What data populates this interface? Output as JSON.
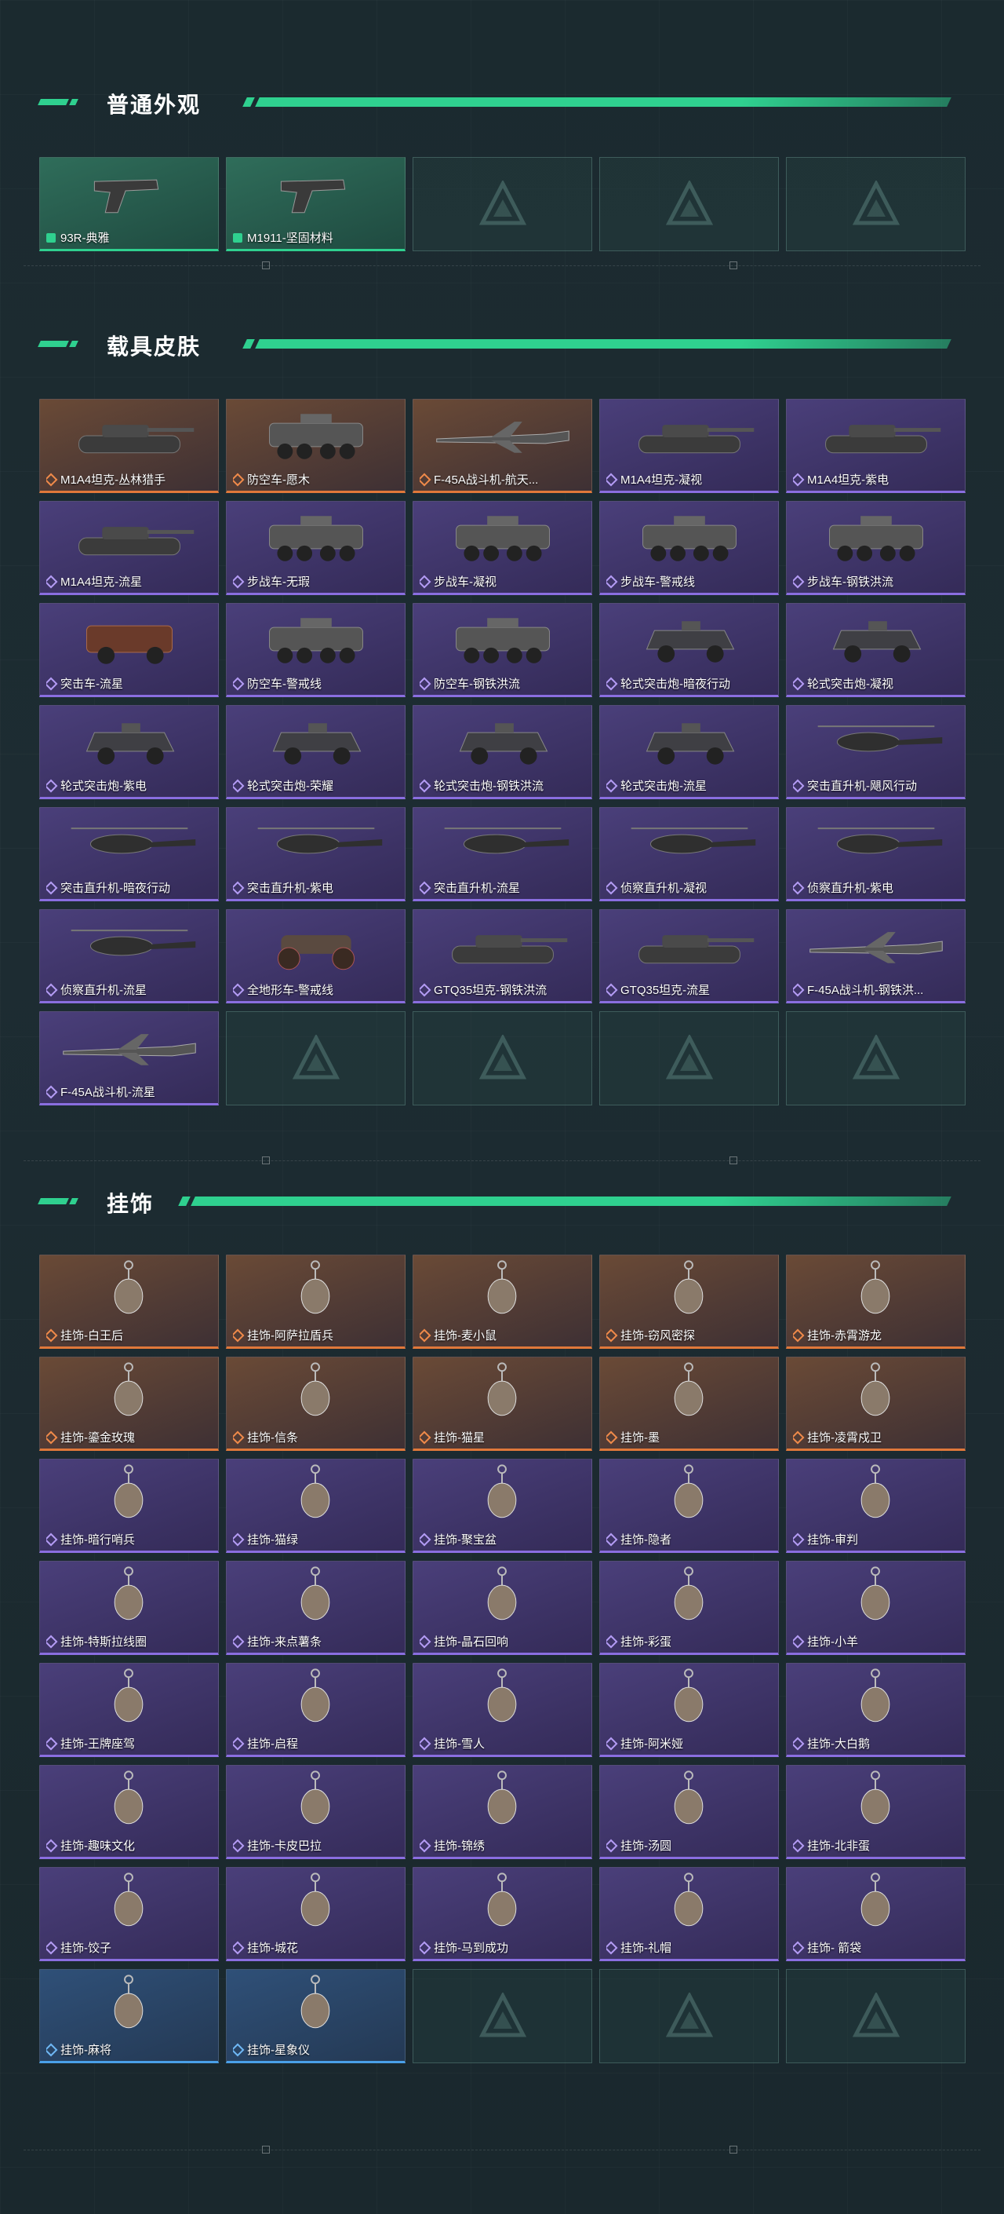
{
  "colors": {
    "accent": "#2fd08f",
    "orange": "#e0783a",
    "purple": "#8a6ee0",
    "blue": "#4aa0e8"
  },
  "sections": [
    {
      "title": "普通外观",
      "items": [
        {
          "label": "93R-典雅",
          "rarity": "green",
          "icon": "pistol-icon"
        },
        {
          "label": "M1911-坚固材料",
          "rarity": "green",
          "icon": "pistol-icon"
        },
        {
          "label": "",
          "rarity": "empty",
          "icon": "placeholder-logo-icon"
        },
        {
          "label": "",
          "rarity": "empty",
          "icon": "placeholder-logo-icon"
        },
        {
          "label": "",
          "rarity": "empty",
          "icon": "placeholder-logo-icon"
        }
      ]
    },
    {
      "title": "载具皮肤",
      "items": [
        {
          "label": "M1A4坦克-丛林猎手",
          "rarity": "orange",
          "icon": "tank-icon"
        },
        {
          "label": "防空车-愿木",
          "rarity": "orange",
          "icon": "apc-icon"
        },
        {
          "label": "F-45A战斗机-航天...",
          "rarity": "orange",
          "icon": "jet-icon"
        },
        {
          "label": "M1A4坦克-凝视",
          "rarity": "purple",
          "icon": "tank-icon"
        },
        {
          "label": "M1A4坦克-紫电",
          "rarity": "purple",
          "icon": "tank-icon"
        },
        {
          "label": "M1A4坦克-流星",
          "rarity": "purple",
          "icon": "tank-icon"
        },
        {
          "label": "步战车-无瑕",
          "rarity": "purple",
          "icon": "apc-icon"
        },
        {
          "label": "步战车-凝视",
          "rarity": "purple",
          "icon": "apc-icon"
        },
        {
          "label": "步战车-警戒线",
          "rarity": "purple",
          "icon": "apc-icon"
        },
        {
          "label": "步战车-钢铁洪流",
          "rarity": "purple",
          "icon": "apc-icon"
        },
        {
          "label": "突击车-流星",
          "rarity": "purple",
          "icon": "truck-icon"
        },
        {
          "label": "防空车-警戒线",
          "rarity": "purple",
          "icon": "apc-icon"
        },
        {
          "label": "防空车-钢铁洪流",
          "rarity": "purple",
          "icon": "apc-icon"
        },
        {
          "label": "轮式突击炮-暗夜行动",
          "rarity": "purple",
          "icon": "armored-car-icon"
        },
        {
          "label": "轮式突击炮-凝视",
          "rarity": "purple",
          "icon": "armored-car-icon"
        },
        {
          "label": "轮式突击炮-紫电",
          "rarity": "purple",
          "icon": "armored-car-icon"
        },
        {
          "label": "轮式突击炮-荣耀",
          "rarity": "purple",
          "icon": "armored-car-icon"
        },
        {
          "label": "轮式突击炮-钢铁洪流",
          "rarity": "purple",
          "icon": "armored-car-icon"
        },
        {
          "label": "轮式突击炮-流星",
          "rarity": "purple",
          "icon": "armored-car-icon"
        },
        {
          "label": "突击直升机-飓风行动",
          "rarity": "purple",
          "icon": "helicopter-icon"
        },
        {
          "label": "突击直升机-暗夜行动",
          "rarity": "purple",
          "icon": "helicopter-icon"
        },
        {
          "label": "突击直升机-紫电",
          "rarity": "purple",
          "icon": "helicopter-icon"
        },
        {
          "label": "突击直升机-流星",
          "rarity": "purple",
          "icon": "helicopter-icon"
        },
        {
          "label": "侦察直升机-凝视",
          "rarity": "purple",
          "icon": "helicopter-icon"
        },
        {
          "label": "侦察直升机-紫电",
          "rarity": "purple",
          "icon": "helicopter-icon"
        },
        {
          "label": "侦察直升机-流星",
          "rarity": "purple",
          "icon": "helicopter-icon"
        },
        {
          "label": "全地形车-警戒线",
          "rarity": "purple",
          "icon": "atv-icon"
        },
        {
          "label": "GTQ35坦克-钢铁洪流",
          "rarity": "purple",
          "icon": "tank-icon"
        },
        {
          "label": "GTQ35坦克-流星",
          "rarity": "purple",
          "icon": "tank-icon"
        },
        {
          "label": "F-45A战斗机-钢铁洪...",
          "rarity": "purple",
          "icon": "jet-icon"
        },
        {
          "label": "F-45A战斗机-流星",
          "rarity": "purple",
          "icon": "jet-icon"
        },
        {
          "label": "",
          "rarity": "empty",
          "icon": "placeholder-logo-icon"
        },
        {
          "label": "",
          "rarity": "empty",
          "icon": "placeholder-logo-icon"
        },
        {
          "label": "",
          "rarity": "empty",
          "icon": "placeholder-logo-icon"
        },
        {
          "label": "",
          "rarity": "empty",
          "icon": "placeholder-logo-icon"
        }
      ]
    },
    {
      "title": "挂饰",
      "items": [
        {
          "label": "挂饰-白王后",
          "rarity": "orange",
          "icon": "charm-icon"
        },
        {
          "label": "挂饰-阿萨拉盾兵",
          "rarity": "orange",
          "icon": "charm-icon"
        },
        {
          "label": "挂饰-麦小鼠",
          "rarity": "orange",
          "icon": "charm-icon"
        },
        {
          "label": "挂饰-窃风密探",
          "rarity": "orange",
          "icon": "charm-icon"
        },
        {
          "label": "挂饰-赤霄游龙",
          "rarity": "orange",
          "icon": "charm-icon"
        },
        {
          "label": "挂饰-鎏金玫瑰",
          "rarity": "orange",
          "icon": "charm-icon"
        },
        {
          "label": "挂饰-信条",
          "rarity": "orange",
          "icon": "charm-icon"
        },
        {
          "label": "挂饰-猫星",
          "rarity": "orange",
          "icon": "charm-icon"
        },
        {
          "label": "挂饰-墨",
          "rarity": "orange",
          "icon": "charm-icon"
        },
        {
          "label": "挂饰-凌霄戍卫",
          "rarity": "orange",
          "icon": "charm-icon"
        },
        {
          "label": "挂饰-暗行哨兵",
          "rarity": "purple",
          "icon": "charm-icon"
        },
        {
          "label": "挂饰-猫绿",
          "rarity": "purple",
          "icon": "charm-icon"
        },
        {
          "label": "挂饰-聚宝盆",
          "rarity": "purple",
          "icon": "charm-icon"
        },
        {
          "label": "挂饰-隐者",
          "rarity": "purple",
          "icon": "charm-icon"
        },
        {
          "label": "挂饰-审判",
          "rarity": "purple",
          "icon": "charm-icon"
        },
        {
          "label": "挂饰-特斯拉线圈",
          "rarity": "purple",
          "icon": "charm-icon"
        },
        {
          "label": "挂饰-来点薯条",
          "rarity": "purple",
          "icon": "charm-icon"
        },
        {
          "label": "挂饰-晶石回响",
          "rarity": "purple",
          "icon": "charm-icon"
        },
        {
          "label": "挂饰-彩蛋",
          "rarity": "purple",
          "icon": "charm-icon"
        },
        {
          "label": "挂饰-小羊",
          "rarity": "purple",
          "icon": "charm-icon"
        },
        {
          "label": "挂饰-王牌座驾",
          "rarity": "purple",
          "icon": "charm-icon"
        },
        {
          "label": "挂饰-启程",
          "rarity": "purple",
          "icon": "charm-icon"
        },
        {
          "label": "挂饰-雪人",
          "rarity": "purple",
          "icon": "charm-icon"
        },
        {
          "label": "挂饰-阿米娅",
          "rarity": "purple",
          "icon": "charm-icon"
        },
        {
          "label": "挂饰-大白鹅",
          "rarity": "purple",
          "icon": "charm-icon"
        },
        {
          "label": "挂饰-趣味文化",
          "rarity": "purple",
          "icon": "charm-icon"
        },
        {
          "label": "挂饰-卡皮巴拉",
          "rarity": "purple",
          "icon": "charm-icon"
        },
        {
          "label": "挂饰-锦绣",
          "rarity": "purple",
          "icon": "charm-icon"
        },
        {
          "label": "挂饰-汤圆",
          "rarity": "purple",
          "icon": "charm-icon"
        },
        {
          "label": "挂饰-北非蛋",
          "rarity": "purple",
          "icon": "charm-icon"
        },
        {
          "label": "挂饰-饺子",
          "rarity": "purple",
          "icon": "charm-icon"
        },
        {
          "label": "挂饰-城花",
          "rarity": "purple",
          "icon": "charm-icon"
        },
        {
          "label": "挂饰-马到成功",
          "rarity": "purple",
          "icon": "charm-icon"
        },
        {
          "label": "挂饰-礼帽",
          "rarity": "purple",
          "icon": "charm-icon"
        },
        {
          "label": "挂饰- 箭袋",
          "rarity": "purple",
          "icon": "charm-icon"
        },
        {
          "label": "挂饰-麻将",
          "rarity": "blue",
          "icon": "charm-icon"
        },
        {
          "label": "挂饰-星象仪",
          "rarity": "blue",
          "icon": "charm-icon"
        },
        {
          "label": "",
          "rarity": "empty",
          "icon": "placeholder-logo-icon"
        },
        {
          "label": "",
          "rarity": "empty",
          "icon": "placeholder-logo-icon"
        },
        {
          "label": "",
          "rarity": "empty",
          "icon": "placeholder-logo-icon"
        }
      ]
    }
  ]
}
